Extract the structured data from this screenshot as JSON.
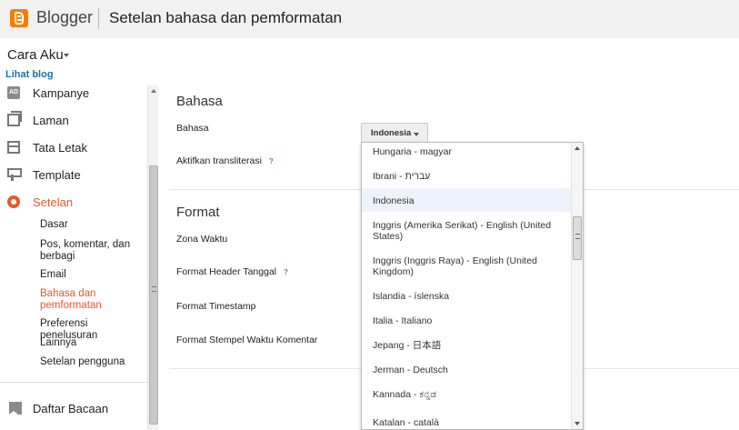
{
  "header": {
    "brand": "Blogger",
    "title": "Setelan bahasa dan pemformatan"
  },
  "blog": {
    "name": "Cara Aku",
    "view_link": "Lihat blog"
  },
  "sidebar": {
    "items": [
      {
        "label": "Kampanye",
        "icon": "campaign-icon"
      },
      {
        "label": "Laman",
        "icon": "pages-icon"
      },
      {
        "label": "Tata Letak",
        "icon": "layout-icon"
      },
      {
        "label": "Template",
        "icon": "template-icon"
      },
      {
        "label": "Setelan",
        "icon": "gear-icon"
      }
    ],
    "sub_items": [
      "Dasar",
      "Pos, komentar, dan berbagi",
      "Email",
      "Bahasa dan pemformatan",
      "Preferensi penelusuran",
      "Lainnya",
      "Setelan pengguna"
    ],
    "reading_list": "Daftar Bacaan",
    "active_color": "#e8582d"
  },
  "main": {
    "language_section": {
      "title": "Bahasa",
      "language_label": "Bahasa",
      "language_value": "Indonesia",
      "transliteration_label": "Aktifkan transliterasi",
      "help": "?"
    },
    "format_section": {
      "title": "Format",
      "timezone_label": "Zona Waktu",
      "header_date_label": "Format Header Tanggal",
      "timestamp_label": "Format Timestamp",
      "comment_timestamp_label": "Format Stempel Waktu Komentar",
      "help": "?"
    }
  },
  "dropdown": {
    "options": [
      "Hungaria - magyar",
      "Ibrani - עברית",
      "Indonesia",
      "Inggris (Amerika Serikat) - English (United States)",
      "Inggris (Inggris Raya) - English (United Kingdom)",
      "Islandia - íslenska",
      "Italia - Italiano",
      "Jepang - 日本語",
      "Jerman - Deutsch",
      "Kannada - ಕನ್ನಡ",
      "Katalan - català"
    ],
    "selected": "Indonesia"
  }
}
